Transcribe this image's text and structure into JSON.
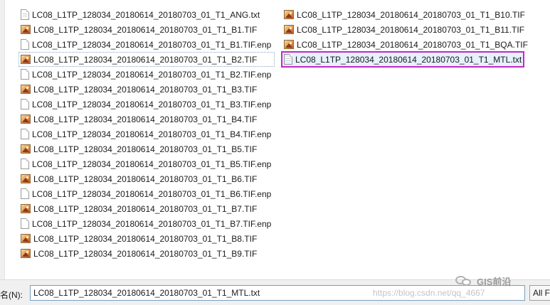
{
  "files_col1": [
    {
      "name": "LC08_L1TP_128034_20180614_20180703_01_T1_ANG.txt",
      "icon": "text-file-icon"
    },
    {
      "name": "LC08_L1TP_128034_20180614_20180703_01_T1_B1.TIF",
      "icon": "image-file-icon"
    },
    {
      "name": "LC08_L1TP_128034_20180614_20180703_01_T1_B1.TIF.enp",
      "icon": "blank-file-icon"
    },
    {
      "name": "LC08_L1TP_128034_20180614_20180703_01_T1_B2.TIF",
      "icon": "image-file-icon"
    },
    {
      "name": "LC08_L1TP_128034_20180614_20180703_01_T1_B2.TIF.enp",
      "icon": "blank-file-icon"
    },
    {
      "name": "LC08_L1TP_128034_20180614_20180703_01_T1_B3.TIF",
      "icon": "image-file-icon"
    },
    {
      "name": "LC08_L1TP_128034_20180614_20180703_01_T1_B3.TIF.enp",
      "icon": "blank-file-icon"
    },
    {
      "name": "LC08_L1TP_128034_20180614_20180703_01_T1_B4.TIF",
      "icon": "image-file-icon"
    },
    {
      "name": "LC08_L1TP_128034_20180614_20180703_01_T1_B4.TIF.enp",
      "icon": "blank-file-icon"
    },
    {
      "name": "LC08_L1TP_128034_20180614_20180703_01_T1_B5.TIF",
      "icon": "image-file-icon"
    },
    {
      "name": "LC08_L1TP_128034_20180614_20180703_01_T1_B5.TIF.enp",
      "icon": "blank-file-icon"
    },
    {
      "name": "LC08_L1TP_128034_20180614_20180703_01_T1_B6.TIF",
      "icon": "image-file-icon"
    },
    {
      "name": "LC08_L1TP_128034_20180614_20180703_01_T1_B6.TIF.enp",
      "icon": "blank-file-icon"
    },
    {
      "name": "LC08_L1TP_128034_20180614_20180703_01_T1_B7.TIF",
      "icon": "image-file-icon"
    },
    {
      "name": "LC08_L1TP_128034_20180614_20180703_01_T1_B7.TIF.enp",
      "icon": "blank-file-icon"
    },
    {
      "name": "LC08_L1TP_128034_20180614_20180703_01_T1_B8.TIF",
      "icon": "image-file-icon"
    },
    {
      "name": "LC08_L1TP_128034_20180614_20180703_01_T1_B9.TIF",
      "icon": "image-file-icon"
    }
  ],
  "files_col2": [
    {
      "name": "LC08_L1TP_128034_20180614_20180703_01_T1_B10.TIF",
      "icon": "image-file-icon"
    },
    {
      "name": "LC08_L1TP_128034_20180614_20180703_01_T1_B11.TIF",
      "icon": "image-file-icon"
    },
    {
      "name": "LC08_L1TP_128034_20180614_20180703_01_T1_BQA.TIF",
      "icon": "image-file-icon"
    },
    {
      "name": "LC08_L1TP_128034_20180614_20180703_01_T1_MTL.txt",
      "icon": "text-file-icon"
    }
  ],
  "selected_file": "LC08_L1TP_128034_20180614_20180703_01_T1_MTL.txt",
  "focused_file": "LC08_L1TP_128034_20180614_20180703_01_T1_B2.TIF",
  "bottom_bar": {
    "filename_label": "名(N):",
    "filename_value": "LC08_L1TP_128034_20180614_20180703_01_T1_MTL.txt",
    "filter_value": "All F"
  },
  "watermark": {
    "url": "https://blog.csdn.net/qq_4667",
    "brand": "GIS前沿",
    "brand_icon": "wechat-icon"
  },
  "colors": {
    "selection_outline": "#c228c9",
    "selection_fill": "#e5f1fb"
  }
}
